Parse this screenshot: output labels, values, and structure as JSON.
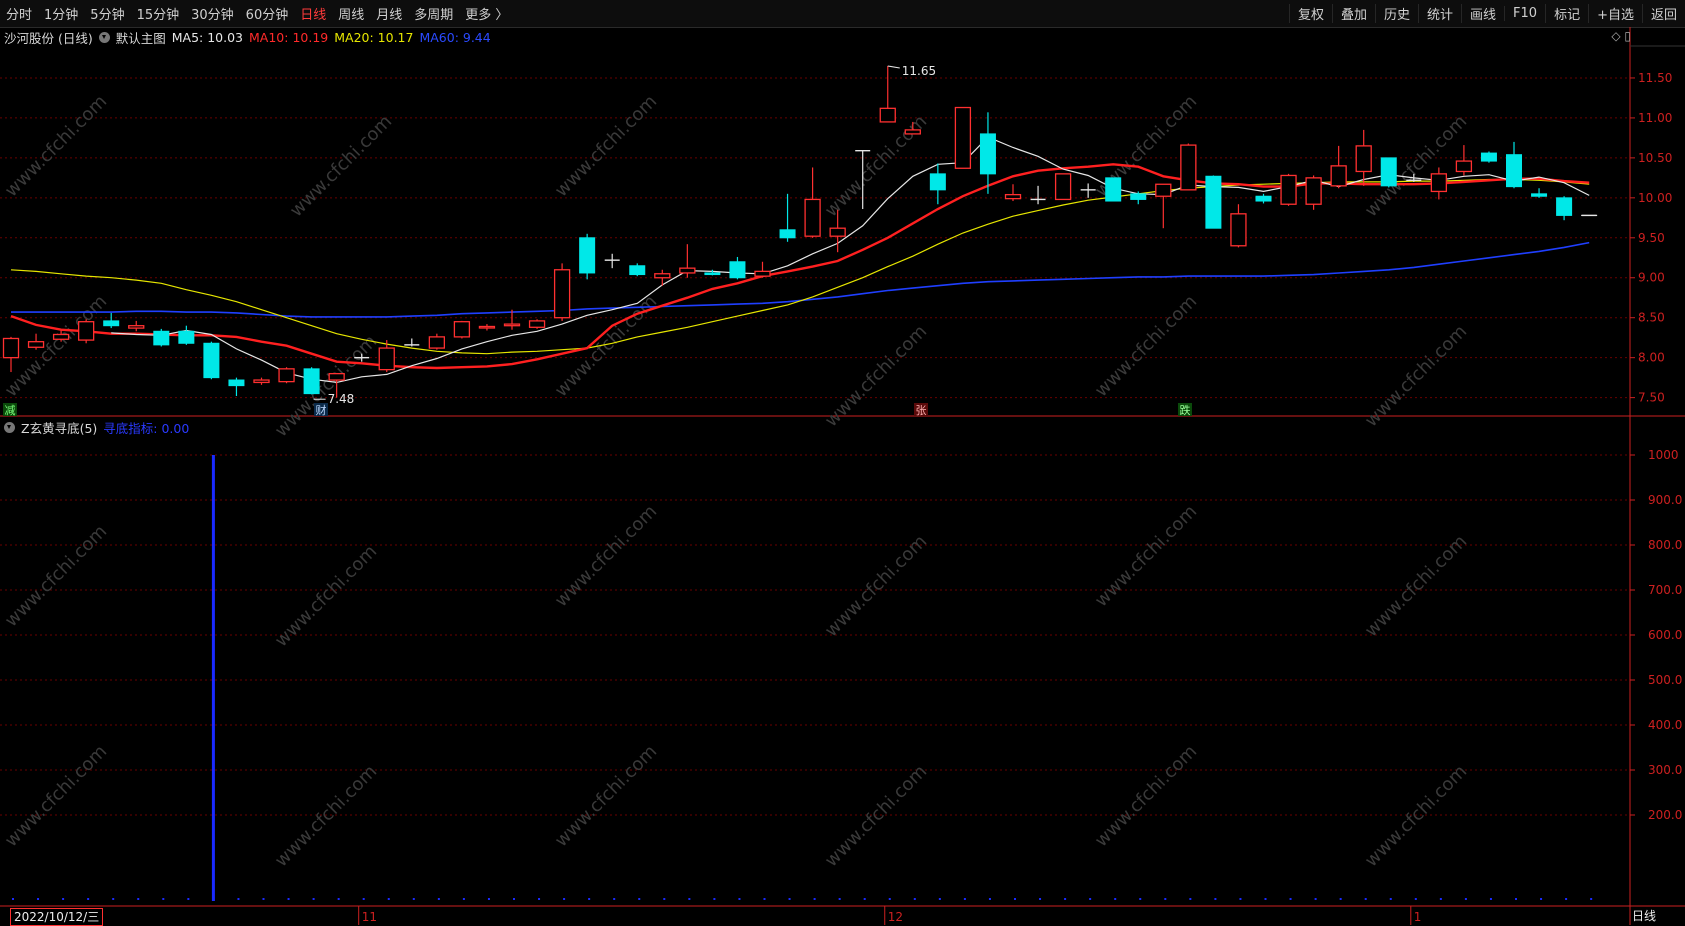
{
  "toolbar": {
    "periods": [
      "分时",
      "1分钟",
      "5分钟",
      "15分钟",
      "30分钟",
      "60分钟",
      "日线",
      "周线",
      "月线",
      "多周期",
      "更多 〉"
    ],
    "active_period": "日线",
    "right_buttons": [
      "复权",
      "叠加",
      "历史",
      "统计",
      "画线",
      "F10",
      "标记",
      "+自选",
      "返回"
    ]
  },
  "header": {
    "stock": "沙河股份 (日线)",
    "main_chart": "默认主图",
    "ma5": "MA5: 10.03",
    "ma10": "MA10: 10.19",
    "ma20": "MA20: 10.17",
    "ma60": "MA60: 9.44"
  },
  "sub_header": {
    "indicator": "Z玄黄寻底(5)",
    "line": "寻底指标: 0.00"
  },
  "colors": {
    "up": "#ff3030",
    "down": "#00e8e8",
    "ma5": "#e6e6e6",
    "ma10": "#ff2020",
    "ma20": "#e6e600",
    "ma60": "#1f3fff",
    "grid": "#6a0000",
    "axis": "#cc2020"
  },
  "markers": {
    "high": "11.65",
    "low": "7.48",
    "tag1": "减",
    "tag2": "财",
    "tag3": "张",
    "tag4": "跌"
  },
  "footer": {
    "date": "2022/10/12/三",
    "period": "日线",
    "month_labels": [
      "11",
      "12",
      "1"
    ]
  },
  "watermark": "www.cfchi.com",
  "chart_data": [
    {
      "type": "candlestick",
      "y_ticks": [
        "7.50",
        "8.00",
        "8.50",
        "9.00",
        "9.50",
        "10.00",
        "10.50",
        "11.00",
        "11.50"
      ],
      "ylim": [
        7.32,
        11.9
      ],
      "candles": [
        [
          8.0,
          8.24,
          7.82,
          8.26
        ],
        [
          8.13,
          8.2,
          8.1,
          8.3
        ],
        [
          8.23,
          8.29,
          8.2,
          8.34
        ],
        [
          8.22,
          8.45,
          8.18,
          8.48
        ],
        [
          8.46,
          8.4,
          8.37,
          8.56
        ],
        [
          8.37,
          8.4,
          8.33,
          8.46
        ],
        [
          8.33,
          8.16,
          8.14,
          8.36
        ],
        [
          8.33,
          8.18,
          8.16,
          8.4
        ],
        [
          8.18,
          7.75,
          7.73,
          8.2
        ],
        [
          7.72,
          7.65,
          7.52,
          7.75
        ],
        [
          7.69,
          7.72,
          7.66,
          7.75
        ],
        [
          7.7,
          7.86,
          7.68,
          7.88
        ],
        [
          7.86,
          7.55,
          7.54,
          7.88
        ],
        [
          7.72,
          7.8,
          7.5,
          7.8
        ],
        [
          8.0,
          8.0,
          7.95,
          8.05
        ],
        [
          7.85,
          8.12,
          7.82,
          8.22
        ],
        [
          8.16,
          8.16,
          8.14,
          8.24
        ],
        [
          8.12,
          8.26,
          8.1,
          8.3
        ],
        [
          8.26,
          8.45,
          8.24,
          8.46
        ],
        [
          8.38,
          8.39,
          8.34,
          8.42
        ],
        [
          8.4,
          8.42,
          8.35,
          8.6
        ],
        [
          8.38,
          8.46,
          8.36,
          8.48
        ],
        [
          8.5,
          9.1,
          8.46,
          9.18
        ],
        [
          9.5,
          9.06,
          8.98,
          9.55
        ],
        [
          9.22,
          9.22,
          9.12,
          9.3
        ],
        [
          9.15,
          9.04,
          9.02,
          9.18
        ],
        [
          9.0,
          9.05,
          8.9,
          9.1
        ],
        [
          9.06,
          9.12,
          9.0,
          9.42
        ],
        [
          9.06,
          9.04,
          9.03,
          9.1
        ],
        [
          9.2,
          9.0,
          8.98,
          9.26
        ],
        [
          9.02,
          9.08,
          9.0,
          9.2
        ],
        [
          9.6,
          9.5,
          9.45,
          10.05
        ],
        [
          9.52,
          9.98,
          9.5,
          10.38
        ],
        [
          9.52,
          9.62,
          9.32,
          9.85
        ],
        [
          10.59,
          10.59,
          9.86,
          10.59
        ],
        [
          10.95,
          11.12,
          10.96,
          11.65
        ],
        [
          10.8,
          10.85,
          10.8,
          10.95
        ],
        [
          10.3,
          10.1,
          9.92,
          10.43
        ],
        [
          10.37,
          11.13,
          10.37,
          11.13
        ],
        [
          10.8,
          10.3,
          10.05,
          11.07
        ],
        [
          9.99,
          10.04,
          9.96,
          10.17
        ],
        [
          9.98,
          9.98,
          9.92,
          10.15
        ],
        [
          9.98,
          10.3,
          9.98,
          10.3
        ],
        [
          10.1,
          10.1,
          10.0,
          10.18
        ],
        [
          10.25,
          9.96,
          9.96,
          10.25
        ],
        [
          10.05,
          9.98,
          9.92,
          10.08
        ],
        [
          10.02,
          10.17,
          9.62,
          10.17
        ],
        [
          10.1,
          10.66,
          10.1,
          10.68
        ],
        [
          10.27,
          9.62,
          9.62,
          10.28
        ],
        [
          9.4,
          9.8,
          9.38,
          9.92
        ],
        [
          10.02,
          9.96,
          9.93,
          10.05
        ],
        [
          9.92,
          10.28,
          9.9,
          10.3
        ],
        [
          9.92,
          10.25,
          9.85,
          10.28
        ],
        [
          10.15,
          10.4,
          10.12,
          10.65
        ],
        [
          10.33,
          10.65,
          10.15,
          10.85
        ],
        [
          10.5,
          10.15,
          10.13,
          10.5
        ],
        [
          10.22,
          10.22,
          10.2,
          10.3
        ],
        [
          10.08,
          10.3,
          9.98,
          10.38
        ],
        [
          10.33,
          10.46,
          10.28,
          10.66
        ],
        [
          10.56,
          10.46,
          10.44,
          10.58
        ],
        [
          10.54,
          10.14,
          10.12,
          10.7
        ],
        [
          10.05,
          10.02,
          10.0,
          10.12
        ],
        [
          10.0,
          9.78,
          9.72,
          10.02
        ],
        [
          9.78,
          9.78,
          9.78,
          9.78
        ]
      ],
      "series": [
        {
          "name": "MA5",
          "values": [
            null,
            null,
            null,
            null,
            8.31,
            8.29,
            8.28,
            8.34,
            8.29,
            8.11,
            7.97,
            7.81,
            7.73,
            7.69,
            7.76,
            7.79,
            7.9,
            7.99,
            8.11,
            8.2,
            8.28,
            8.33,
            8.42,
            8.53,
            8.6,
            8.68,
            8.91,
            9.09,
            9.08,
            9.06,
            9.05,
            9.15,
            9.3,
            9.43,
            9.65,
            9.99,
            10.27,
            10.42,
            10.44,
            10.76,
            10.63,
            10.52,
            10.36,
            10.28,
            10.12,
            10.05,
            10.04,
            10.16,
            10.14,
            10.13,
            10.08,
            10.14,
            10.22,
            10.14,
            10.23,
            10.29,
            10.25,
            10.22,
            10.27,
            10.29,
            10.21,
            10.26,
            10.19,
            10.03
          ]
        },
        {
          "name": "MA10",
          "values": [
            8.52,
            8.41,
            8.35,
            8.33,
            8.3,
            8.3,
            8.29,
            8.28,
            8.28,
            8.26,
            8.2,
            8.15,
            8.05,
            7.95,
            7.93,
            7.9,
            7.88,
            7.87,
            7.88,
            7.89,
            7.92,
            7.98,
            8.05,
            8.12,
            8.4,
            8.55,
            8.65,
            8.75,
            8.86,
            8.93,
            9.02,
            9.08,
            9.14,
            9.21,
            9.35,
            9.5,
            9.68,
            9.86,
            10.02,
            10.15,
            10.27,
            10.34,
            10.37,
            10.39,
            10.42,
            10.39,
            10.27,
            10.22,
            10.18,
            10.17,
            10.14,
            10.14,
            10.18,
            10.18,
            10.17,
            10.17,
            10.17,
            10.18,
            10.2,
            10.22,
            10.24,
            10.24,
            10.21,
            10.19
          ]
        },
        {
          "name": "MA20",
          "values": [
            9.1,
            9.08,
            9.05,
            9.02,
            9.0,
            8.97,
            8.93,
            8.85,
            8.78,
            8.7,
            8.6,
            8.5,
            8.4,
            8.3,
            8.23,
            8.17,
            8.12,
            8.08,
            8.06,
            8.05,
            8.07,
            8.08,
            8.1,
            8.12,
            8.18,
            8.26,
            8.32,
            8.38,
            8.45,
            8.52,
            8.59,
            8.66,
            8.76,
            8.88,
            9.0,
            9.14,
            9.27,
            9.42,
            9.56,
            9.67,
            9.77,
            9.84,
            9.91,
            9.97,
            10.01,
            10.05,
            10.09,
            10.12,
            10.14,
            10.16,
            10.17,
            10.18,
            10.19,
            10.2,
            10.2,
            10.2,
            10.21,
            10.21,
            10.22,
            10.23,
            10.23,
            10.22,
            10.2,
            10.17
          ]
        },
        {
          "name": "MA60",
          "values": [
            8.57,
            8.57,
            8.57,
            8.57,
            8.57,
            8.58,
            8.58,
            8.57,
            8.57,
            8.56,
            8.54,
            8.52,
            8.51,
            8.51,
            8.51,
            8.51,
            8.52,
            8.53,
            8.55,
            8.56,
            8.57,
            8.58,
            8.59,
            8.61,
            8.62,
            8.63,
            8.64,
            8.65,
            8.66,
            8.67,
            8.68,
            8.7,
            8.73,
            8.76,
            8.8,
            8.84,
            8.87,
            8.9,
            8.93,
            8.95,
            8.96,
            8.97,
            8.98,
            8.99,
            9.0,
            9.01,
            9.01,
            9.02,
            9.02,
            9.02,
            9.02,
            9.03,
            9.04,
            9.06,
            9.08,
            9.1,
            9.13,
            9.17,
            9.21,
            9.25,
            9.29,
            9.33,
            9.38,
            9.44
          ]
        }
      ]
    },
    {
      "type": "bar",
      "name": "寻底指标",
      "y_ticks": [
        "200.0",
        "300.0",
        "400.0",
        "500.0",
        "600.0",
        "700.0",
        "800.0",
        "900.0",
        "1000"
      ],
      "ylim": [
        0,
        1020
      ],
      "spike_index": 8,
      "spike_value": 1000,
      "tick_indices": [
        0,
        1,
        2,
        3,
        4,
        5,
        6,
        7,
        9,
        10,
        11,
        12,
        13,
        14,
        15,
        16,
        17,
        18,
        19,
        20,
        21,
        22,
        23,
        24,
        25,
        26,
        27,
        28,
        29,
        30,
        31,
        32,
        33,
        34,
        35,
        36,
        37,
        38,
        39,
        40,
        41,
        42,
        43,
        44,
        45,
        46,
        47,
        48,
        49,
        50,
        51,
        52,
        53,
        54,
        55,
        56,
        57,
        58,
        59,
        60,
        61,
        62,
        63
      ]
    }
  ]
}
